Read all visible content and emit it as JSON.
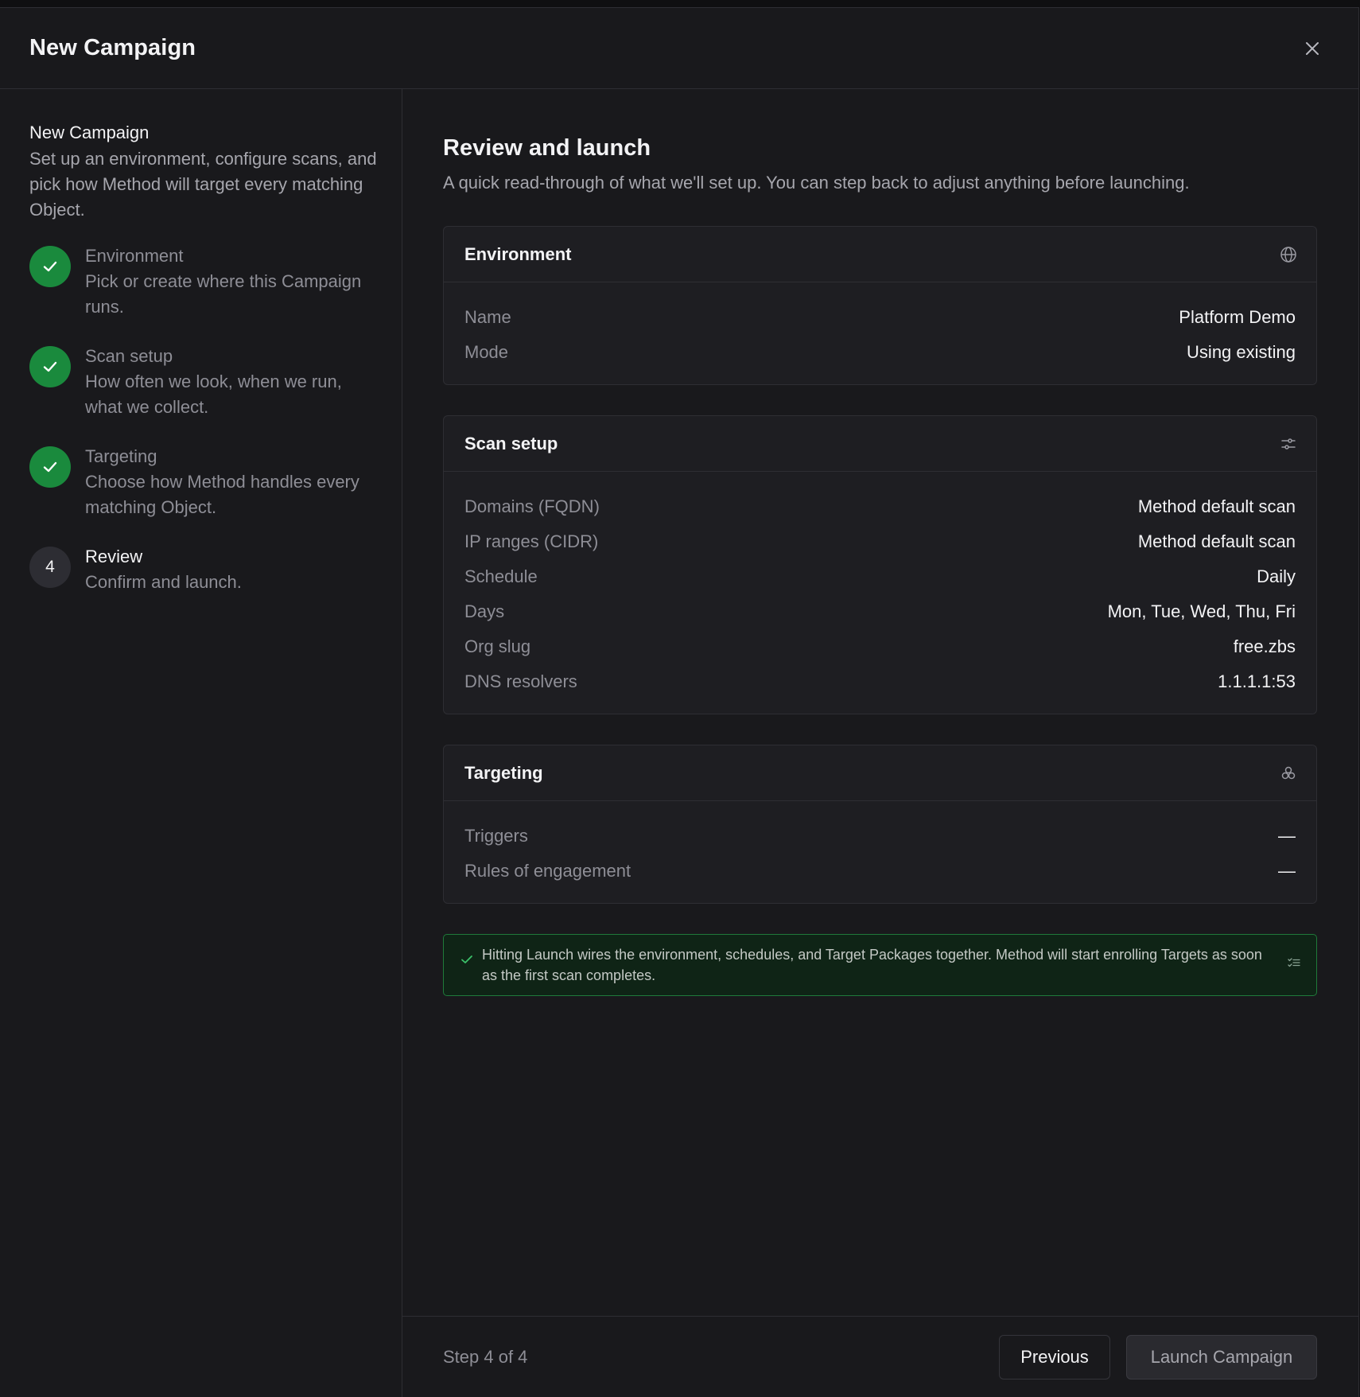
{
  "header": {
    "title": "New Campaign"
  },
  "sidebar": {
    "title": "New Campaign",
    "description": "Set up an environment, configure scans, and pick how Method will target every matching Object.",
    "steps": [
      {
        "number": "1",
        "label": "Environment",
        "description": "Pick or create where this Campaign runs.",
        "status": "complete"
      },
      {
        "number": "2",
        "label": "Scan setup",
        "description": "How often we look, when we run, what we collect.",
        "status": "complete"
      },
      {
        "number": "3",
        "label": "Targeting",
        "description": "Choose how Method handles every matching Object.",
        "status": "complete"
      },
      {
        "number": "4",
        "label": "Review",
        "description": "Confirm and launch.",
        "status": "current"
      }
    ]
  },
  "main": {
    "title": "Review and launch",
    "subtitle": "A quick read-through of what we'll set up. You can step back to adjust anything before launching.",
    "cards": {
      "environment": {
        "title": "Environment",
        "icon": "globe-icon",
        "rows": [
          {
            "label": "Name",
            "value": "Platform Demo"
          },
          {
            "label": "Mode",
            "value": "Using existing"
          }
        ]
      },
      "scan": {
        "title": "Scan setup",
        "icon": "sliders-icon",
        "rows": [
          {
            "label": "Domains (FQDN)",
            "value": "Method default scan"
          },
          {
            "label": "IP ranges (CIDR)",
            "value": "Method default scan"
          },
          {
            "label": "Schedule",
            "value": "Daily"
          },
          {
            "label": "Days",
            "value": "Mon, Tue, Wed, Thu, Fri"
          },
          {
            "label": "Org slug",
            "value": "free.zbs"
          },
          {
            "label": "DNS resolvers",
            "value": "1.1.1.1:53"
          }
        ]
      },
      "targeting": {
        "title": "Targeting",
        "icon": "cubes-icon",
        "rows": [
          {
            "label": "Triggers",
            "value": "—"
          },
          {
            "label": "Rules of engagement",
            "value": "—"
          }
        ]
      }
    },
    "notice": "Hitting Launch wires the environment, schedules, and Target Packages together. Method will start enrolling Targets as soon as the first scan completes."
  },
  "footer": {
    "step_text": "Step 4 of 4",
    "previous_label": "Previous",
    "launch_label": "Launch Campaign"
  },
  "colors": {
    "background": "#19191c",
    "success": "#1a8a3d",
    "notice_bg": "#0f2416",
    "notice_border": "#1f7a3a"
  }
}
